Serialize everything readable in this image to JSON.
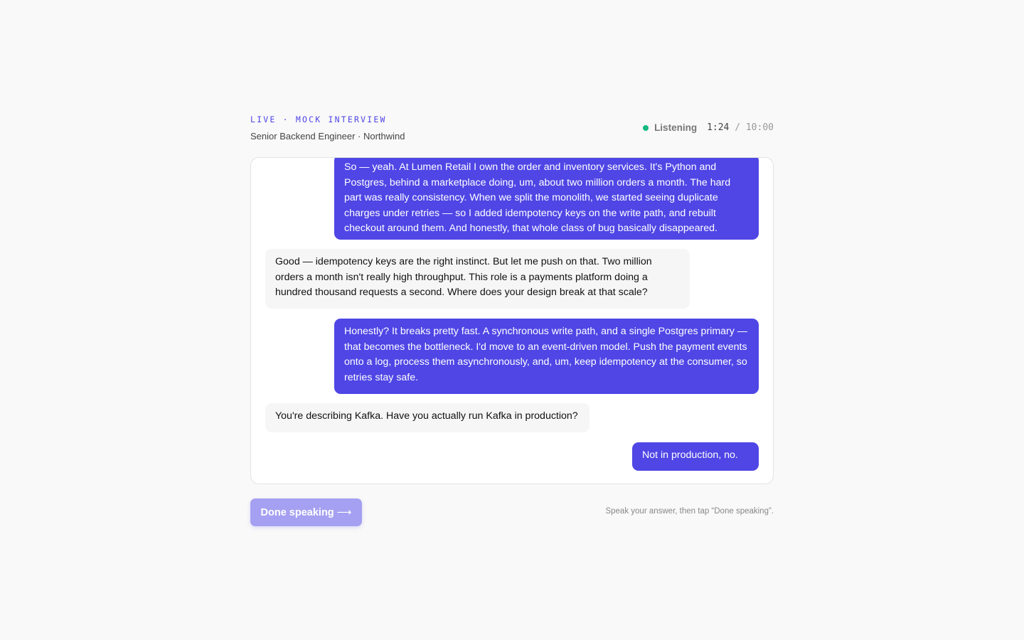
{
  "header": {
    "eyebrow": "LIVE · MOCK INTERVIEW",
    "role": "Senior Backend Engineer · Northwind",
    "status": {
      "label": "Listening",
      "color": "#10b981"
    },
    "timer": {
      "elapsed": "1:24",
      "separator": "/",
      "total": "10:00"
    }
  },
  "messages": [
    {
      "speaker": "candidate",
      "text": "So — yeah. At Lumen Retail I own the order and inventory services. It's Python and Postgres, behind a marketplace doing, um, about two million orders a month. The hard part was really consistency. When we split the monolith, we started seeing duplicate charges under retries — so I added idempotency keys on the write path, and rebuilt checkout around them. And honestly, that whole class of bug basically disappeared."
    },
    {
      "speaker": "interviewer",
      "text": "Good — idempotency keys are the right instinct. But let me push on that. Two million orders a month isn't really high throughput. This role is a payments platform doing a hundred thousand requests a second. Where does your design break at that scale?"
    },
    {
      "speaker": "candidate",
      "text": "Honestly? It breaks pretty fast. A synchronous write path, and a single Postgres primary — that becomes the bottleneck. I'd move to an event-driven model. Push the payment events onto a log, process them asynchronously, and, um, keep idempotency at the consumer, so retries stay safe."
    },
    {
      "speaker": "interviewer",
      "text": "You're describing Kafka. Have you actually run Kafka in production?"
    },
    {
      "speaker": "candidate",
      "text": "Not in production, no. ..."
    }
  ],
  "footer": {
    "done_label": "Done speaking",
    "done_arrow": "⟶",
    "hint": "Speak your answer, then tap “Done speaking”."
  },
  "colors": {
    "accent": "#4f46e5",
    "button_disabled": "#a5a0f1"
  }
}
